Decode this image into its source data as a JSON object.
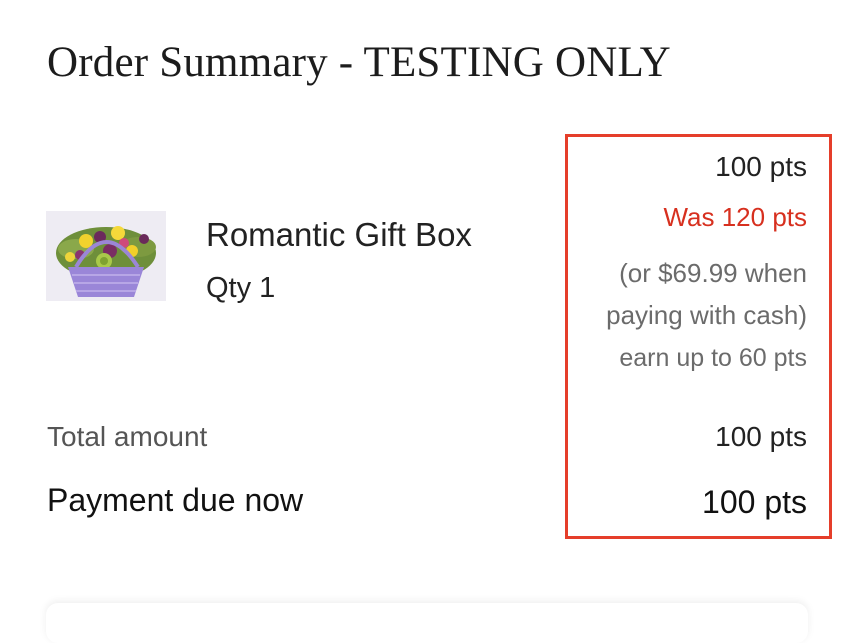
{
  "page": {
    "title": "Order Summary - TESTING ONLY"
  },
  "item": {
    "name": "Romantic Gift Box",
    "qty": "Qty 1",
    "image_icon": "flower-basket-image"
  },
  "pricing": {
    "price": "100 pts",
    "was": "Was 120 pts",
    "cash_line1": "(or $69.99 when",
    "cash_line2": "paying with cash)",
    "earn": "earn up to 60 pts",
    "highlight_color": "#e53e2a",
    "was_color": "#d7301f"
  },
  "totals": {
    "total_label": "Total amount",
    "total_value": "100 pts",
    "due_label": "Payment due now",
    "due_value": "100 pts"
  }
}
